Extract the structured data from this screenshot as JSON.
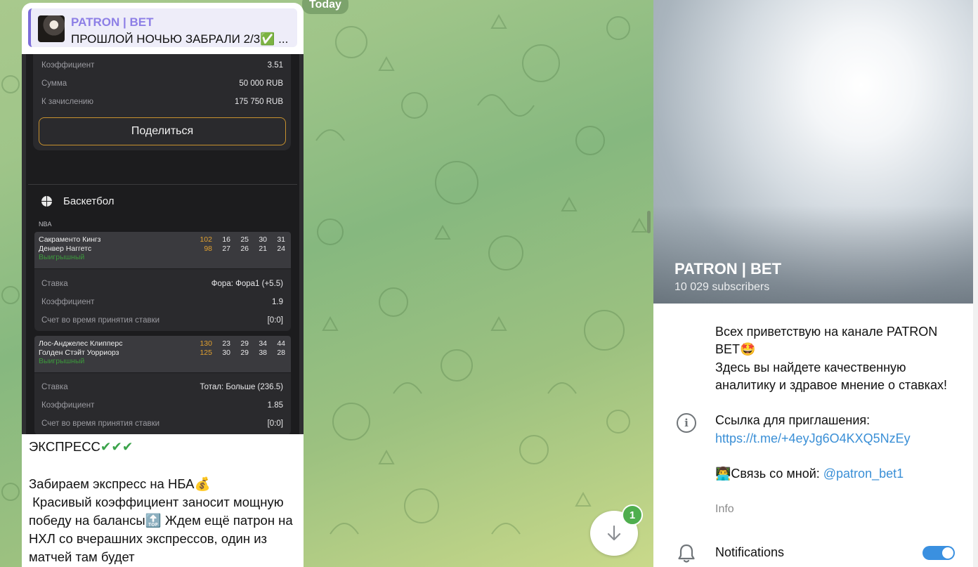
{
  "chat": {
    "date_label": "Today",
    "reply": {
      "sender": "PATRON | BET",
      "text": "ПРОШЛОЙ НОЧЬЮ ЗАБРАЛИ 2/3✅ ..."
    },
    "screenshot": {
      "bet_rows": [
        {
          "label": "Коэффициент",
          "value": "3.51"
        },
        {
          "label": "Сумма",
          "value": "50 000 RUB"
        },
        {
          "label": "К зачислению",
          "value": "175 750 RUB"
        }
      ],
      "share_button": "Поделиться",
      "sport": "Баскетбол",
      "league": "NBA",
      "games": [
        {
          "team1": "Сакраменто Кингз",
          "team2": "Денвер Наггетс",
          "scores1": [
            "102",
            "16",
            "25",
            "30",
            "31"
          ],
          "scores2": [
            "98",
            "27",
            "26",
            "21",
            "24"
          ],
          "status": "Выигрышный",
          "details": [
            {
              "label": "Ставка",
              "value": "Фора: Фора1 (+5.5)"
            },
            {
              "label": "Коэффициент",
              "value": "1.9"
            },
            {
              "label": "Счет во время принятия ставки",
              "value": "[0:0]"
            }
          ]
        },
        {
          "team1": "Лос-Анджелес Клипперс",
          "team2": "Голден Стэйт Уорриорз",
          "scores1": [
            "130",
            "23",
            "29",
            "34",
            "44"
          ],
          "scores2": [
            "125",
            "30",
            "29",
            "38",
            "28"
          ],
          "status": "Выигрышный",
          "details": [
            {
              "label": "Ставка",
              "value": "Тотал: Больше (236.5)"
            },
            {
              "label": "Коэффициент",
              "value": "1.85"
            },
            {
              "label": "Счет во время принятия ставки",
              "value": "[0:0]"
            }
          ]
        }
      ]
    },
    "message": {
      "line1": "ЭКСПРЕСС",
      "line1_emoji": "✔✔✔",
      "line2": "Забираем экспресс на НБА",
      "line2_emoji": "💰",
      "line3": " Красивый коэффициент заносит мощную победу на балансы",
      "line3_emoji": "🔝",
      "line4": " Ждем ещё патрон на НХЛ со вчерашних экспрессов, один из матчей там будет"
    },
    "scroll_down_badge": "1"
  },
  "info": {
    "channel_name": "PATRON | BET",
    "subscribers": "10 029 subscribers",
    "description": {
      "p1": "Всех приветствую на канале PATRON BET",
      "p1_emoji": "🤩",
      "p2": "Здесь вы найдете качественную аналитику и здравое мнение о ставках!",
      "p3": "Ссылка для приглашения:",
      "invite_link": "https://t.me/+4eyJg6O4KXQ5NzEy",
      "contact_emoji": "👨‍💻",
      "contact_text": "Связь со мной: ",
      "contact_handle": "@patron_bet1"
    },
    "description_label": "Info",
    "notifications_label": "Notifications",
    "notifications_enabled": true
  },
  "colors": {
    "accent": "#3a90e0",
    "reply_name": "#8d7fe6",
    "win_green": "#3c9a3c",
    "score_orange": "#e0a030",
    "badge_green": "#4fae4e"
  },
  "icons": [
    "basketball-icon",
    "info-icon",
    "bell-icon",
    "arrow-down-icon"
  ]
}
